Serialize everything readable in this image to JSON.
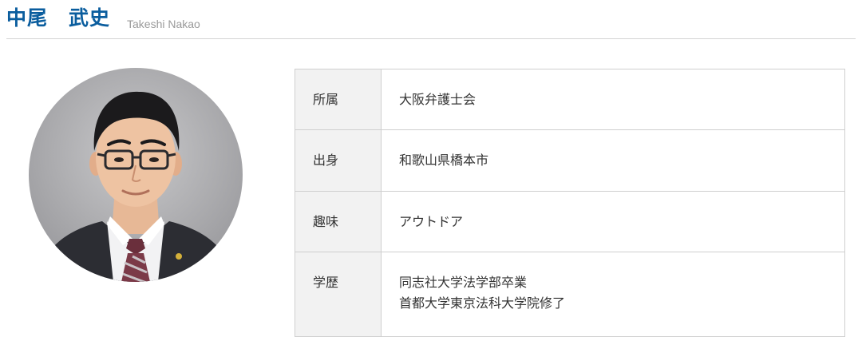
{
  "profile": {
    "name_ja": "中尾　武史",
    "name_en": "Takeshi Nakao",
    "photo": "portrait-photo"
  },
  "table": {
    "rows": [
      {
        "label": "所属",
        "values": [
          "大阪弁護士会"
        ]
      },
      {
        "label": "出身",
        "values": [
          "和歌山県橋本市"
        ]
      },
      {
        "label": "趣味",
        "values": [
          "アウトドア"
        ]
      },
      {
        "label": "学歴",
        "values": [
          "同志社大学法学部卒業",
          "首都大学東京法科大学院修了"
        ]
      }
    ]
  },
  "colors": {
    "name_accent": "#0a5d9e",
    "label_cell_bg": "#f2f2f2",
    "border": "#cfcfcf"
  }
}
